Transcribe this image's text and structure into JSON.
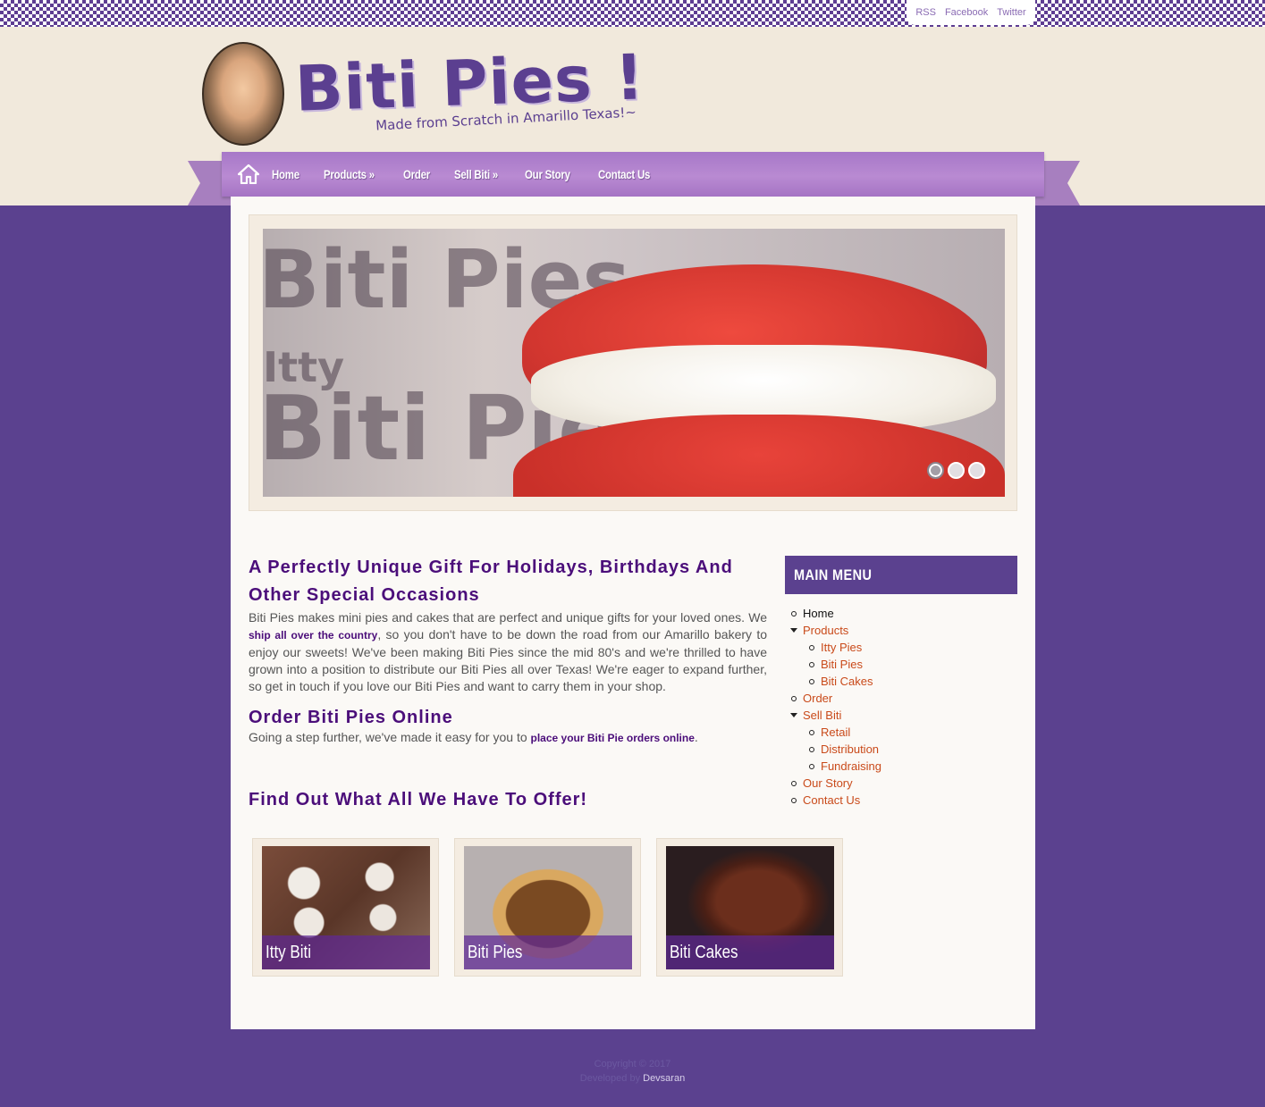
{
  "social": {
    "rss": "RSS",
    "facebook": "Facebook",
    "twitter": "Twitter"
  },
  "brand": {
    "title": "Biti Pies !",
    "tagline": "Made from Scratch in Amarillo Texas!~"
  },
  "nav": {
    "home": "Home",
    "products": "Products »",
    "order": "Order",
    "sell": "Sell Biti »",
    "story": "Our Story",
    "contact": "Contact Us"
  },
  "slider": {
    "brand_text_1": "Biti Pies",
    "brand_text_2": "Itty",
    "brand_text_3": "Biti Pie",
    "slides": 3,
    "active_slide": 1
  },
  "main": {
    "intro_heading": "A Perfectly Unique Gift For Holidays, Birthdays And Other Special Occasions",
    "intro_p1": "Biti Pies makes mini pies and cakes that are perfect and unique gifts for your loved ones. We ",
    "intro_link": "ship all over the country",
    "intro_p2": ", so you don't have to be down the road from our Amarillo bakery to enjoy our sweets! We've been making Biti Pies since the mid 80's and we're thrilled to have grown into a position to distribute our Biti Pies all over Texas! We're eager to expand further, so get in touch if you love our Biti Pies and want to carry them in your shop.",
    "order_heading": "Order Biti Pies Online",
    "order_p1": "Going a step further, we've made it easy for you to ",
    "order_link": "place your Biti Pie orders online",
    "order_p2": ".",
    "find_heading": "Find Out What All We Have To Offer!"
  },
  "tiles": [
    {
      "caption": "Itty Biti"
    },
    {
      "caption": "Biti Pies"
    },
    {
      "caption": "Biti Cakes"
    }
  ],
  "sidebar": {
    "heading": "MAIN MENU",
    "items": {
      "home": "Home",
      "products": "Products",
      "itty": "Itty Pies",
      "biti_pies": "Biti Pies",
      "biti_cakes": "Biti Cakes",
      "order": "Order",
      "sell": "Sell Biti",
      "retail": "Retail",
      "distribution": "Distribution",
      "fundraising": "Fundraising",
      "story": "Our Story",
      "contact": "Contact Us"
    }
  },
  "footer": {
    "copyright": "Copyright © 2017",
    "developed": "Developed by ",
    "developer": "Devsaran"
  },
  "colors": {
    "accent_purple": "#5b418f",
    "heading_purple": "#4b0e7a",
    "link_orange": "#c94a1a",
    "nav_lilac": "#b98ad2"
  }
}
